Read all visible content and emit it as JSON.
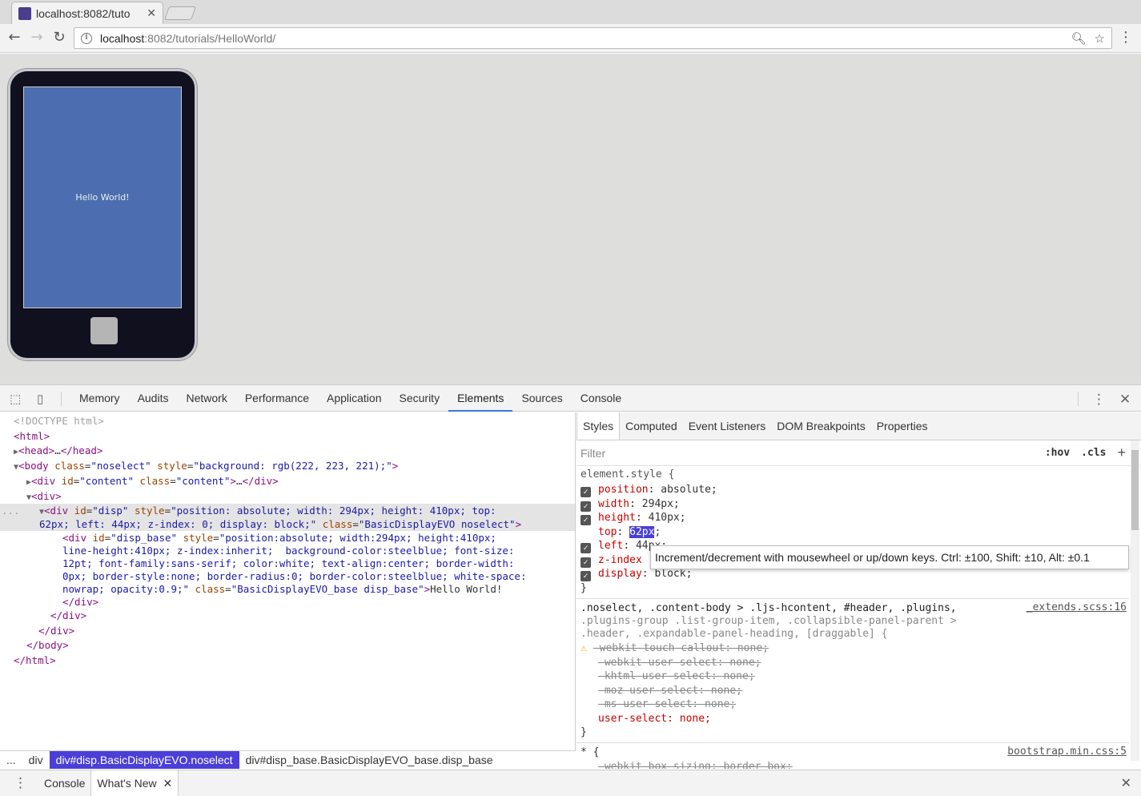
{
  "browser": {
    "tab_title": "localhost:8082/tuto",
    "url_host": "localhost",
    "url_rest": ":8082/tutorials/HelloWorld/"
  },
  "page": {
    "screen_text": "Hello World!"
  },
  "devtools": {
    "tabs": [
      "Memory",
      "Audits",
      "Network",
      "Performance",
      "Application",
      "Security",
      "Elements",
      "Sources",
      "Console"
    ],
    "active_tab": "Elements",
    "tree": {
      "doctype": "<!DOCTYPE html>",
      "html_open": "html",
      "head": "head",
      "body_attr_class": "noselect",
      "body_attr_style": "background: rgb(222, 223, 221);",
      "content_id": "content",
      "content_class": "content",
      "disp_style_1": "position: absolute; width: 294px; height: 410px; top:",
      "disp_style_2": "62px; left: 44px; z-index: 0; display: block;",
      "disp_class": "BasicDisplayEVO noselect",
      "base_style_1": "position:absolute; width:294px; height:410px;",
      "base_style_2": "line-height:410px; z-index:inherit;  background-color:steelblue; font-size:",
      "base_style_3": "12pt; font-family:sans-serif; color:white; text-align:center; border-width:",
      "base_style_4": "0px; border-style:none; border-radius:0; border-color:steelblue; white-space:",
      "base_style_5": "nowrap; opacity:0.9;",
      "base_class": "BasicDisplayEVO_base disp_base",
      "base_text": "Hello World!"
    },
    "breadcrumb": [
      "...",
      "div",
      "div#disp.BasicDisplayEVO.noselect",
      "div#disp_base.BasicDisplayEVO_base.disp_base"
    ],
    "styles_tabs": [
      "Styles",
      "Computed",
      "Event Listeners",
      "DOM Breakpoints",
      "Properties"
    ],
    "filter_placeholder": "Filter",
    "hov": ":hov",
    "cls": ".cls",
    "element_style": {
      "selector": "element.style {",
      "position": "absolute;",
      "width": "294px;",
      "height": "410px;",
      "top_value": "62px",
      "left_partial": "44px;",
      "display": "block;"
    },
    "tooltip": "Increment/decrement with mousewheel or up/down keys. Ctrl: ±100, Shift: ±10, Alt: ±0.1",
    "rule2": {
      "selector_1": ".noselect, .content-body > .ljs-hcontent, #header, .plugins,",
      "selector_2": ".plugins-group .list-group-item, .collapsible-panel-parent >",
      "selector_3": ".header, .expandable-panel-heading, [draggable] {",
      "source": "_extends.scss:16",
      "props": [
        "-webkit-touch-callout: none;",
        "-webkit-user-select: none;",
        "-khtml-user-select: none;",
        "-moz-user-select: none;",
        "-ms-user-select: none;"
      ],
      "user_select": "user-select: none;"
    },
    "rule3": {
      "selector": "* {",
      "source": "bootstrap.min.css:5",
      "partial": "-webkit-box-sizing: border-box;"
    },
    "drawer_tabs": [
      "Console",
      "What's New"
    ]
  }
}
